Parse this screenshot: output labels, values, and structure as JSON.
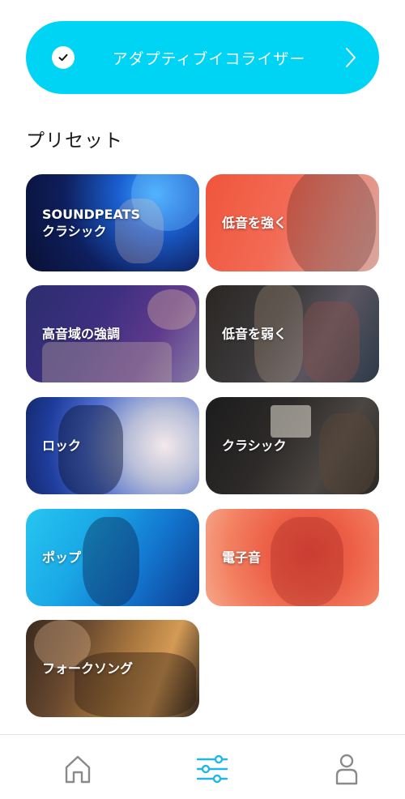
{
  "adaptive_eq": {
    "label": "アダプティブイコライザー",
    "enabled": true,
    "color": "#00d4f5"
  },
  "presets": {
    "title": "プリセット",
    "items": [
      {
        "id": "soundpeats-classic",
        "label": "SOUNDPEATS\nクラシック"
      },
      {
        "id": "bass-boost",
        "label": "低音を強く"
      },
      {
        "id": "treble-boost",
        "label": "高音域の強調"
      },
      {
        "id": "bass-reduce",
        "label": "低音を弱く"
      },
      {
        "id": "rock",
        "label": "ロック"
      },
      {
        "id": "classical",
        "label": "クラシック"
      },
      {
        "id": "pop",
        "label": "ポップ"
      },
      {
        "id": "electronic",
        "label": "電子音"
      },
      {
        "id": "folk",
        "label": "フォークソング"
      }
    ]
  },
  "tabbar": {
    "items": [
      {
        "icon": "home-icon",
        "active": false
      },
      {
        "icon": "equalizer-icon",
        "active": true
      },
      {
        "icon": "profile-icon",
        "active": false
      }
    ],
    "active_color": "#1fb6e8",
    "inactive_color": "#8a8a8a"
  }
}
